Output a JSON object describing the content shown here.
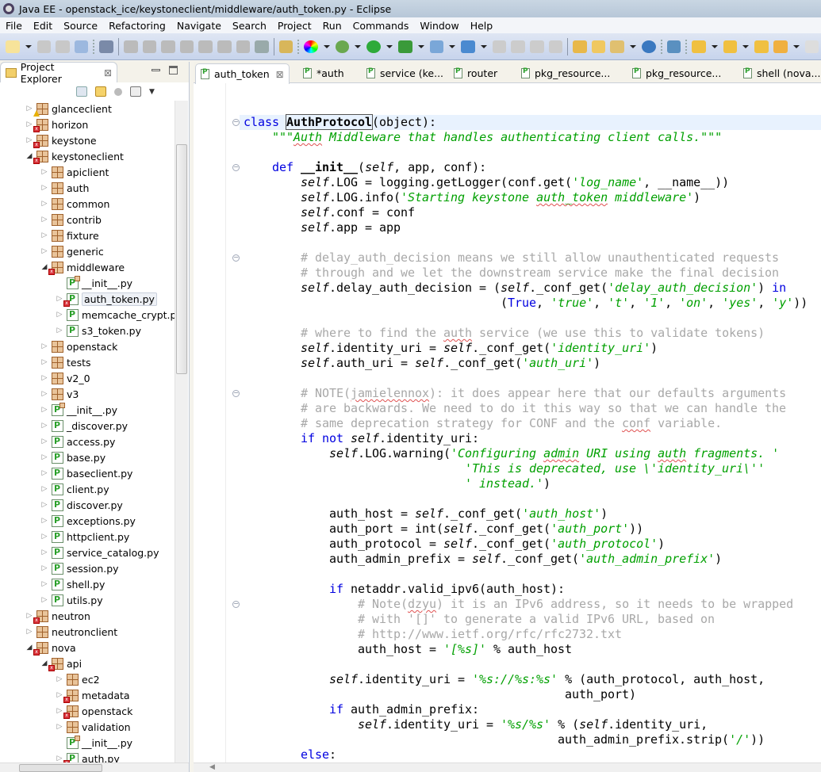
{
  "window": {
    "title": "Java EE - openstack_ice/keystoneclient/middleware/auth_token.py - Eclipse"
  },
  "menu": [
    "File",
    "Edit",
    "Source",
    "Refactoring",
    "Navigate",
    "Search",
    "Project",
    "Run",
    "Commands",
    "Window",
    "Help"
  ],
  "toolbar": {
    "icons": [
      "new-wizard-icon",
      "save-icon",
      "save-all-icon",
      "print-icon",
      "skip-breakpoints-icon",
      "resume-icon",
      "suspend-icon",
      "terminate-icon",
      "disconnect-icon",
      "step-into-icon",
      "step-over-icon",
      "step-return-icon",
      "drop-to-frame-icon",
      "use-step-filters-icon",
      "color-wheel-icon",
      "debug-icon",
      "run-icon",
      "run-external-tool-icon",
      "new-server-icon",
      "new-class-icon",
      "open-folder-icon",
      "open-folder-icon",
      "open-folder-icon",
      "open-folder-icon",
      "open-project-icon",
      "open-file-icon",
      "edit-icon",
      "globe-icon",
      "web-service-icon",
      "next-annotation-icon",
      "prev-annotation-icon",
      "last-edit-icon",
      "back-icon",
      "forward-icon"
    ]
  },
  "explorer": {
    "title": "Project Explorer",
    "tree": [
      {
        "label": "glanceclient",
        "level": 0,
        "kind": "pkg",
        "state": "closed",
        "marker": "warning"
      },
      {
        "label": "horizon",
        "level": 0,
        "kind": "pkg",
        "state": "closed",
        "marker": "error"
      },
      {
        "label": "keystone",
        "level": 0,
        "kind": "pkg",
        "state": "closed",
        "marker": "error"
      },
      {
        "label": "keystoneclient",
        "level": 0,
        "kind": "pkg",
        "state": "open",
        "marker": "error"
      },
      {
        "label": "apiclient",
        "level": 1,
        "kind": "pkg",
        "state": "closed"
      },
      {
        "label": "auth",
        "level": 1,
        "kind": "pkg",
        "state": "closed"
      },
      {
        "label": "common",
        "level": 1,
        "kind": "pkg",
        "state": "closed"
      },
      {
        "label": "contrib",
        "level": 1,
        "kind": "pkg",
        "state": "closed"
      },
      {
        "label": "fixture",
        "level": 1,
        "kind": "pkg",
        "state": "closed"
      },
      {
        "label": "generic",
        "level": 1,
        "kind": "pkg",
        "state": "closed"
      },
      {
        "label": "middleware",
        "level": 1,
        "kind": "pkg",
        "state": "open",
        "marker": "error"
      },
      {
        "label": "__init__.py",
        "level": 2,
        "kind": "init",
        "state": "none"
      },
      {
        "label": "auth_token.py",
        "level": 2,
        "kind": "py",
        "state": "closed",
        "marker": "error",
        "selected": true
      },
      {
        "label": "memcache_crypt.py",
        "level": 2,
        "kind": "py",
        "state": "closed"
      },
      {
        "label": "s3_token.py",
        "level": 2,
        "kind": "py",
        "state": "closed"
      },
      {
        "label": "openstack",
        "level": 1,
        "kind": "pkg",
        "state": "closed"
      },
      {
        "label": "tests",
        "level": 1,
        "kind": "pkg",
        "state": "closed"
      },
      {
        "label": "v2_0",
        "level": 1,
        "kind": "pkg",
        "state": "closed"
      },
      {
        "label": "v3",
        "level": 1,
        "kind": "pkg",
        "state": "closed"
      },
      {
        "label": "__init__.py",
        "level": 1,
        "kind": "init",
        "state": "closed"
      },
      {
        "label": "_discover.py",
        "level": 1,
        "kind": "py",
        "state": "closed"
      },
      {
        "label": "access.py",
        "level": 1,
        "kind": "py",
        "state": "closed"
      },
      {
        "label": "base.py",
        "level": 1,
        "kind": "py",
        "state": "closed"
      },
      {
        "label": "baseclient.py",
        "level": 1,
        "kind": "py",
        "state": "closed"
      },
      {
        "label": "client.py",
        "level": 1,
        "kind": "py",
        "state": "closed"
      },
      {
        "label": "discover.py",
        "level": 1,
        "kind": "py",
        "state": "closed"
      },
      {
        "label": "exceptions.py",
        "level": 1,
        "kind": "py",
        "state": "closed"
      },
      {
        "label": "httpclient.py",
        "level": 1,
        "kind": "py",
        "state": "closed"
      },
      {
        "label": "service_catalog.py",
        "level": 1,
        "kind": "py",
        "state": "closed"
      },
      {
        "label": "session.py",
        "level": 1,
        "kind": "py",
        "state": "closed"
      },
      {
        "label": "shell.py",
        "level": 1,
        "kind": "py",
        "state": "closed"
      },
      {
        "label": "utils.py",
        "level": 1,
        "kind": "py",
        "state": "closed"
      },
      {
        "label": "neutron",
        "level": 0,
        "kind": "pkg",
        "state": "closed",
        "marker": "error"
      },
      {
        "label": "neutronclient",
        "level": 0,
        "kind": "pkg",
        "state": "closed"
      },
      {
        "label": "nova",
        "level": 0,
        "kind": "pkg",
        "state": "open",
        "marker": "error"
      },
      {
        "label": "api",
        "level": 1,
        "kind": "pkg",
        "state": "open",
        "marker": "error"
      },
      {
        "label": "ec2",
        "level": 2,
        "kind": "pkg",
        "state": "closed"
      },
      {
        "label": "metadata",
        "level": 2,
        "kind": "pkg",
        "state": "closed",
        "marker": "error"
      },
      {
        "label": "openstack",
        "level": 2,
        "kind": "pkg",
        "state": "closed",
        "marker": "error"
      },
      {
        "label": "validation",
        "level": 2,
        "kind": "pkg",
        "state": "closed"
      },
      {
        "label": "__init__.py",
        "level": 2,
        "kind": "init",
        "state": "none"
      },
      {
        "label": "auth.py",
        "level": 2,
        "kind": "py",
        "state": "closed",
        "marker": "error"
      }
    ]
  },
  "editor": {
    "tabs": [
      {
        "label": "auth_token",
        "active": true
      },
      {
        "label": "*auth"
      },
      {
        "label": "service (ke..."
      },
      {
        "label": "router"
      },
      {
        "label": "pkg_resource..."
      },
      {
        "label": "pkg_resource..."
      },
      {
        "label": "shell (nova..."
      }
    ],
    "lines": [
      [],
      [],
      [
        [
          "kw",
          "class "
        ],
        [
          "fn hl",
          "AuthProtocol"
        ],
        [
          "n",
          "(object):"
        ]
      ],
      [
        [
          "n",
          "    "
        ],
        [
          "str",
          "\"\"\""
        ],
        [
          "str sq",
          "Auth"
        ],
        [
          "str",
          " Middleware that handles authenticating client calls.\"\"\""
        ]
      ],
      [],
      [
        [
          "n",
          "    "
        ],
        [
          "kw",
          "def "
        ],
        [
          "fn",
          "__init__"
        ],
        [
          "n",
          "("
        ],
        [
          "slf",
          "self"
        ],
        [
          "n",
          ", app, conf):"
        ]
      ],
      [
        [
          "n",
          "        "
        ],
        [
          "slf",
          "self"
        ],
        [
          "n",
          ".LOG = logging.getLogger(conf.get("
        ],
        [
          "str",
          "'log_name'"
        ],
        [
          "n",
          ", __name__))"
        ]
      ],
      [
        [
          "n",
          "        "
        ],
        [
          "slf",
          "self"
        ],
        [
          "n",
          ".LOG.info("
        ],
        [
          "str",
          "'Starting keystone "
        ],
        [
          "str sq",
          "auth_token"
        ],
        [
          "str",
          " middleware'"
        ],
        [
          "n",
          ")"
        ]
      ],
      [
        [
          "n",
          "        "
        ],
        [
          "slf",
          "self"
        ],
        [
          "n",
          ".conf = conf"
        ]
      ],
      [
        [
          "n",
          "        "
        ],
        [
          "slf",
          "self"
        ],
        [
          "n",
          ".app = app"
        ]
      ],
      [],
      [
        [
          "cm",
          "        # delay_auth_decision means we still allow unauthenticated requests"
        ]
      ],
      [
        [
          "cm",
          "        # through and we let the downstream service make the final decision"
        ]
      ],
      [
        [
          "n",
          "        "
        ],
        [
          "slf",
          "self"
        ],
        [
          "n",
          ".delay_auth_decision = ("
        ],
        [
          "slf",
          "self"
        ],
        [
          "n",
          "._conf_get("
        ],
        [
          "str",
          "'delay_auth_decision'"
        ],
        [
          "n",
          ") "
        ],
        [
          "kw",
          "in"
        ]
      ],
      [
        [
          "n",
          "                                    ("
        ],
        [
          "kw",
          "True"
        ],
        [
          "n",
          ", "
        ],
        [
          "str",
          "'true'"
        ],
        [
          "n",
          ", "
        ],
        [
          "str",
          "'t'"
        ],
        [
          "n",
          ", "
        ],
        [
          "str",
          "'1'"
        ],
        [
          "n",
          ", "
        ],
        [
          "str",
          "'on'"
        ],
        [
          "n",
          ", "
        ],
        [
          "str",
          "'yes'"
        ],
        [
          "n",
          ", "
        ],
        [
          "str",
          "'y'"
        ],
        [
          "n",
          "))"
        ]
      ],
      [],
      [
        [
          "cm",
          "        # where to find the "
        ],
        [
          "cm sq",
          "auth"
        ],
        [
          "cm",
          " service (we use this to validate tokens)"
        ]
      ],
      [
        [
          "n",
          "        "
        ],
        [
          "slf",
          "self"
        ],
        [
          "n",
          ".identity_uri = "
        ],
        [
          "slf",
          "self"
        ],
        [
          "n",
          "._conf_get("
        ],
        [
          "str",
          "'identity_uri'"
        ],
        [
          "n",
          ")"
        ]
      ],
      [
        [
          "n",
          "        "
        ],
        [
          "slf",
          "self"
        ],
        [
          "n",
          ".auth_uri = "
        ],
        [
          "slf",
          "self"
        ],
        [
          "n",
          "._conf_get("
        ],
        [
          "str",
          "'auth_uri'"
        ],
        [
          "n",
          ")"
        ]
      ],
      [],
      [
        [
          "cm",
          "        # NOTE("
        ],
        [
          "cm sq",
          "jamielennox"
        ],
        [
          "cm",
          "): it does appear here that our defaults arguments"
        ]
      ],
      [
        [
          "cm",
          "        # are backwards. We need to do it this way so that we can handle the"
        ]
      ],
      [
        [
          "cm",
          "        # same deprecation strategy for CONF and the "
        ],
        [
          "cm sq",
          "conf"
        ],
        [
          "cm",
          " variable."
        ]
      ],
      [
        [
          "n",
          "        "
        ],
        [
          "kw",
          "if not "
        ],
        [
          "slf",
          "self"
        ],
        [
          "n",
          ".identity_uri:"
        ]
      ],
      [
        [
          "n",
          "            "
        ],
        [
          "slf",
          "self"
        ],
        [
          "n",
          ".LOG.warning("
        ],
        [
          "str",
          "'Configuring "
        ],
        [
          "str sq",
          "admin"
        ],
        [
          "str",
          " URI using "
        ],
        [
          "str sq",
          "auth"
        ],
        [
          "str",
          " fragments. '"
        ]
      ],
      [
        [
          "n",
          "                               "
        ],
        [
          "str",
          "'This is deprecated, use \\'identity_uri\\''"
        ]
      ],
      [
        [
          "n",
          "                               "
        ],
        [
          "str",
          "' instead.'"
        ],
        [
          "n",
          ")"
        ]
      ],
      [],
      [
        [
          "n",
          "            auth_host = "
        ],
        [
          "slf",
          "self"
        ],
        [
          "n",
          "._conf_get("
        ],
        [
          "str",
          "'auth_host'"
        ],
        [
          "n",
          ")"
        ]
      ],
      [
        [
          "n",
          "            auth_port = int("
        ],
        [
          "slf",
          "self"
        ],
        [
          "n",
          "._conf_get("
        ],
        [
          "str",
          "'auth_port'"
        ],
        [
          "n",
          "))"
        ]
      ],
      [
        [
          "n",
          "            auth_protocol = "
        ],
        [
          "slf",
          "self"
        ],
        [
          "n",
          "._conf_get("
        ],
        [
          "str",
          "'auth_protocol'"
        ],
        [
          "n",
          ")"
        ]
      ],
      [
        [
          "n",
          "            auth_admin_prefix = "
        ],
        [
          "slf",
          "self"
        ],
        [
          "n",
          "._conf_get("
        ],
        [
          "str",
          "'auth_admin_prefix'"
        ],
        [
          "n",
          ")"
        ]
      ],
      [],
      [
        [
          "n",
          "            "
        ],
        [
          "kw",
          "if "
        ],
        [
          "n",
          "netaddr.valid_ipv6(auth_host):"
        ]
      ],
      [
        [
          "cm",
          "                # Note("
        ],
        [
          "cm sq",
          "dzyu"
        ],
        [
          "cm",
          ") it is an IPv6 address, so it needs to be wrapped"
        ]
      ],
      [
        [
          "cm",
          "                # with '[]' to generate a valid IPv6 URL, based on"
        ]
      ],
      [
        [
          "cm",
          "                # http://www.ietf.org/rfc/rfc2732.txt"
        ]
      ],
      [
        [
          "n",
          "                auth_host = "
        ],
        [
          "str",
          "'[%s]'"
        ],
        [
          "n",
          " % auth_host"
        ]
      ],
      [],
      [
        [
          "n",
          "            "
        ],
        [
          "slf",
          "self"
        ],
        [
          "n",
          ".identity_uri = "
        ],
        [
          "str",
          "'%s://%s:%s'"
        ],
        [
          "n",
          " % (auth_protocol, auth_host,"
        ]
      ],
      [
        [
          "n",
          "                                             auth_port)"
        ]
      ],
      [
        [
          "n",
          "            "
        ],
        [
          "kw",
          "if "
        ],
        [
          "n",
          "auth_admin_prefix:"
        ]
      ],
      [
        [
          "n",
          "                "
        ],
        [
          "slf",
          "self"
        ],
        [
          "n",
          ".identity_uri = "
        ],
        [
          "str",
          "'%s/%s'"
        ],
        [
          "n",
          " % ("
        ],
        [
          "slf",
          "self"
        ],
        [
          "n",
          ".identity_uri,"
        ]
      ],
      [
        [
          "n",
          "                                            auth_admin_prefix.strip("
        ],
        [
          "str",
          "'/'"
        ],
        [
          "n",
          "))"
        ]
      ],
      [
        [
          "n",
          "        "
        ],
        [
          "kw",
          "else"
        ],
        [
          "n",
          ":"
        ]
      ]
    ],
    "fold_lines": [
      2,
      5,
      11,
      20,
      34
    ]
  }
}
